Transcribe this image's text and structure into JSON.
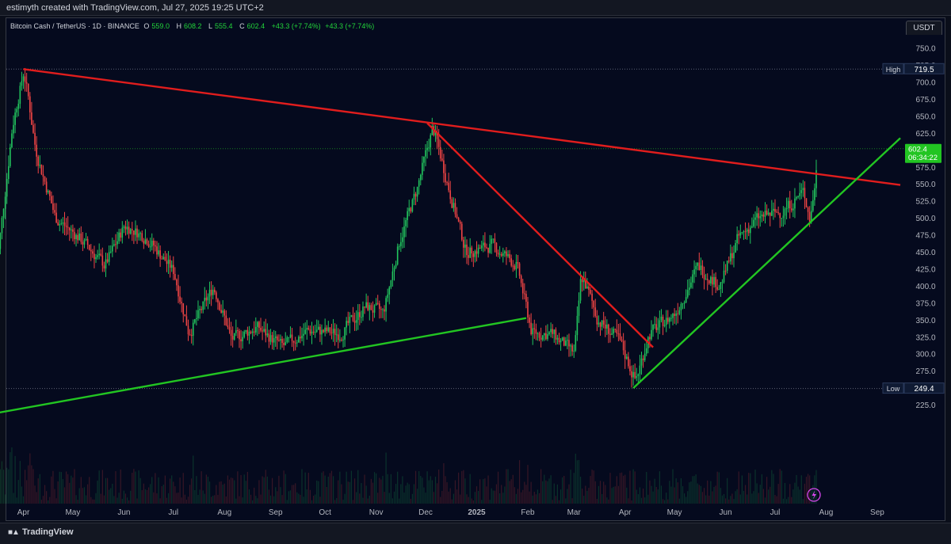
{
  "header": {
    "credit": "estimyth created with TradingView.com, Jul 27, 2025 19:25 UTC+2"
  },
  "legend": {
    "symbol": "Bitcoin Cash / TetherUS · 1D · BINANCE",
    "o_label": "O",
    "o_value": "559.0",
    "h_label": "H",
    "h_value": "608.2",
    "l_label": "L",
    "l_value": "555.4",
    "c_label": "C",
    "c_value": "602.4",
    "change1": "+43.3 (+7.74%)",
    "change2": "+43.3 (+7.74%)"
  },
  "currency": "USDT",
  "price_axis": {
    "ticks": [
      "750.0",
      "725.0",
      "700.0",
      "675.0",
      "650.0",
      "625.0",
      "600.0",
      "575.0",
      "550.0",
      "525.0",
      "500.0",
      "475.0",
      "450.0",
      "425.0",
      "400.0",
      "375.0",
      "350.0",
      "325.0",
      "300.0",
      "275.0",
      "250.0",
      "225.0"
    ],
    "high_label": "High",
    "high_value": "719.5",
    "low_label": "Low",
    "low_value": "249.4",
    "last_price": "602.4",
    "countdown": "06:34:22"
  },
  "time_axis": {
    "labels": [
      "Apr",
      "May",
      "Jun",
      "Jul",
      "Aug",
      "Sep",
      "Oct",
      "Nov",
      "Dec",
      "2025",
      "Feb",
      "Mar",
      "Apr",
      "May",
      "Jun",
      "Jul",
      "Aug",
      "Sep"
    ]
  },
  "colors": {
    "up": "#22c55e",
    "down": "#ef4444",
    "resistance": "#e11d1d",
    "support": "#22c522",
    "last_badge": "#22c522",
    "background": "#050a1e"
  },
  "chart_data": {
    "type": "candlestick",
    "title": "Bitcoin Cash / TetherUS · 1D · BINANCE",
    "ylim": [
      205,
      755
    ],
    "trendlines": [
      {
        "from": [
          "2024-04-01",
          719.5
        ],
        "to": [
          "2025-09-15",
          549
        ]
      },
      {
        "from": [
          "2024-12-02",
          640
        ],
        "to": [
          "2025-04-18",
          310
        ]
      },
      {
        "from": [
          "2024-03-15",
          213
        ],
        "to": [
          "2025-01-31",
          353
        ]
      },
      {
        "from": [
          "2025-04-06",
          250
        ],
        "to": [
          "2025-09-15",
          618
        ]
      }
    ],
    "price_path": [
      [
        "2024-03-15",
        420
      ],
      [
        "2024-03-25",
        640
      ],
      [
        "2024-04-01",
        719
      ],
      [
        "2024-04-08",
        600
      ],
      [
        "2024-04-20",
        500
      ],
      [
        "2024-05-05",
        470
      ],
      [
        "2024-05-20",
        430
      ],
      [
        "2024-06-01",
        490
      ],
      [
        "2024-06-15",
        470
      ],
      [
        "2024-07-01",
        420
      ],
      [
        "2024-07-10",
        330
      ],
      [
        "2024-07-25",
        400
      ],
      [
        "2024-08-05",
        320
      ],
      [
        "2024-08-20",
        340
      ],
      [
        "2024-09-05",
        310
      ],
      [
        "2024-09-20",
        335
      ],
      [
        "2024-10-10",
        330
      ],
      [
        "2024-10-25",
        370
      ],
      [
        "2024-11-05",
        360
      ],
      [
        "2024-11-15",
        470
      ],
      [
        "2024-11-25",
        540
      ],
      [
        "2024-12-05",
        635
      ],
      [
        "2024-12-15",
        540
      ],
      [
        "2024-12-25",
        450
      ],
      [
        "2025-01-10",
        460
      ],
      [
        "2025-01-25",
        430
      ],
      [
        "2025-02-03",
        330
      ],
      [
        "2025-02-15",
        330
      ],
      [
        "2025-03-01",
        300
      ],
      [
        "2025-03-05",
        420
      ],
      [
        "2025-03-15",
        350
      ],
      [
        "2025-03-28",
        320
      ],
      [
        "2025-04-07",
        260
      ],
      [
        "2025-04-15",
        330
      ],
      [
        "2025-05-01",
        360
      ],
      [
        "2025-05-15",
        430
      ],
      [
        "2025-05-28",
        400
      ],
      [
        "2025-06-08",
        470
      ],
      [
        "2025-06-20",
        500
      ],
      [
        "2025-07-05",
        510
      ],
      [
        "2025-07-18",
        540
      ],
      [
        "2025-07-22",
        495
      ],
      [
        "2025-07-27",
        602
      ]
    ]
  }
}
